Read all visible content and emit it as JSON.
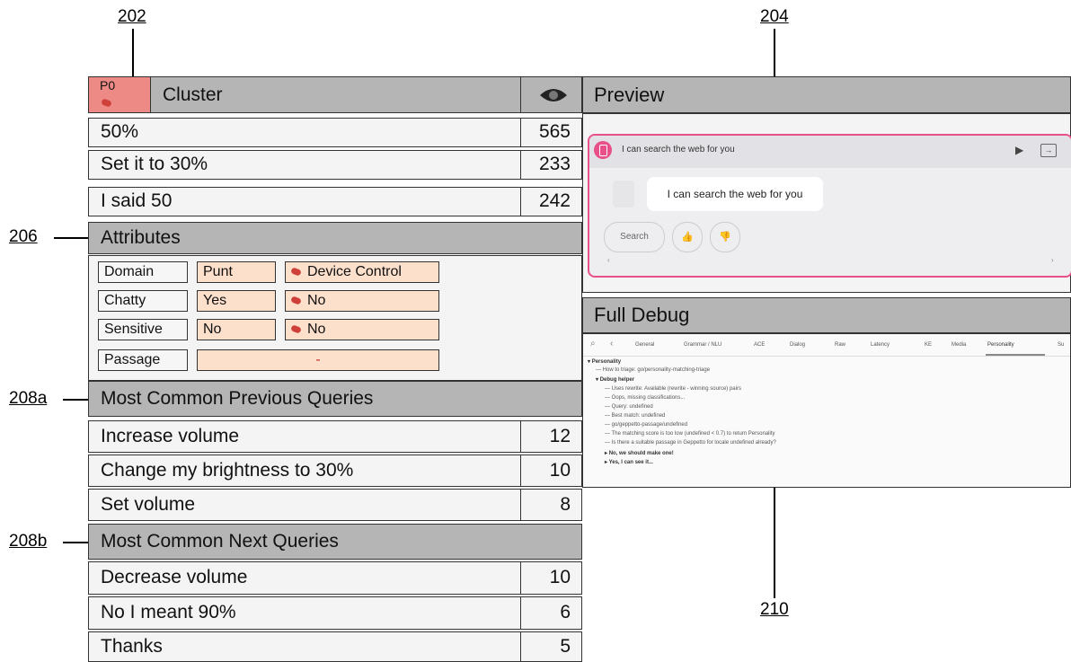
{
  "refs": {
    "r202": "202",
    "r204": "204",
    "r206": "206",
    "r208a": "208a",
    "r208b": "208b",
    "r210": "210"
  },
  "cluster": {
    "badge": "P0",
    "title": "Cluster",
    "rows": [
      {
        "label": "50%",
        "count": "565"
      },
      {
        "label": "Set it to 30%",
        "count": "233"
      },
      {
        "label": "I said 50",
        "count": "242"
      }
    ]
  },
  "attributes": {
    "title": "Attributes",
    "items": [
      {
        "key": "Domain",
        "value": "Punt",
        "predicted": "Device Control"
      },
      {
        "key": "Chatty",
        "value": "Yes",
        "predicted": "No"
      },
      {
        "key": "Sensitive",
        "value": "No",
        "predicted": "No"
      },
      {
        "key": "Passage",
        "value": "-"
      }
    ]
  },
  "previous": {
    "title": "Most Common Previous Queries",
    "rows": [
      {
        "label": "Increase volume",
        "count": "12"
      },
      {
        "label": "Change my brightness to 30%",
        "count": "10"
      },
      {
        "label": "Set volume",
        "count": "8"
      }
    ]
  },
  "next": {
    "title": "Most Common Next Queries",
    "rows": [
      {
        "label": "Decrease volume",
        "count": "10"
      },
      {
        "label": "No I meant 90%",
        "count": "6"
      },
      {
        "label": "Thanks",
        "count": "5"
      }
    ]
  },
  "preview": {
    "title": "Preview",
    "header_text": "I can search the web for you",
    "bubble": "I can search the web for you",
    "search_label": "Search",
    "accent": "#e8508a"
  },
  "debug": {
    "title": "Full Debug",
    "tabs": [
      "General",
      "Grammar / NLU",
      "ACE",
      "Dialog",
      "Raw",
      "Latency",
      "KE",
      "Media",
      "Personality",
      "Su"
    ],
    "lines": [
      "Personality",
      "How to triage: go/personality-matching-triage",
      "Debug helper",
      "Uses rewrite: Available (rewrite - winning source) pairs",
      "Oops, missing classifications...",
      "Query: undefined",
      "Best match: undefined",
      "go/geppetto-passage/undefined",
      "The matching score is too low (undefined < 0.7) to return Personality",
      "Is there a suitable passage in Geppetto for locale undefined already?",
      "No, we should make one!",
      "Yes, I can see it..."
    ]
  }
}
